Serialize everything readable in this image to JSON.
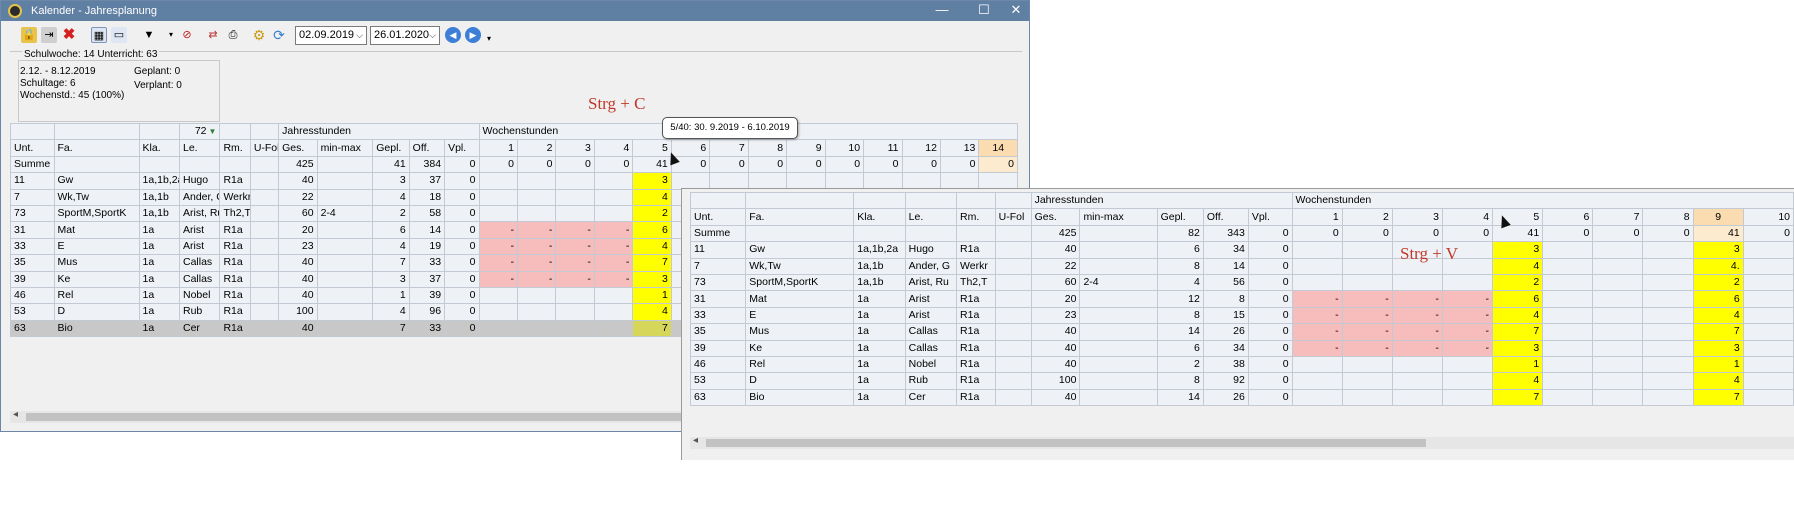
{
  "window": {
    "title": "Kalender - Jahresplanung",
    "controls": {
      "minimize": "—",
      "maximize": "☐",
      "close": "✕"
    }
  },
  "toolbar": {
    "date_from": "02.09.2019",
    "date_to": "26.01.2020"
  },
  "info": {
    "header": "Schulwoche: 14  Unterricht: 63",
    "range": "2.12. - 8.12.2019",
    "schultage": "Schultage: 6",
    "wochenstd": "Wochenstd.: 45 (100%)",
    "geplant": "Geplant: 0",
    "verplant": "Verplant: 0"
  },
  "hints": {
    "copy": "Strg + C",
    "paste": "Strg + V"
  },
  "tooltip": "5/40: 30. 9.2019 - 6.10.2019",
  "grid1": {
    "filter_count": "72",
    "group_jahres": "Jahresstunden",
    "group_wochen": "Wochenstunden",
    "columns": [
      "Unt.",
      "Fa.",
      "Kla.",
      "Le.",
      "Rm.",
      "U-Fol",
      "Ges.",
      "min-max",
      "Gepl.",
      "Off.",
      "Vpl.",
      "1",
      "2",
      "3",
      "4",
      "5",
      "6",
      "7",
      "8",
      "9",
      "10",
      "11",
      "12",
      "13",
      "14"
    ],
    "summe": {
      "label": "Summe",
      "ges": "425",
      "gepl": "41",
      "off": "384",
      "vpl": "0",
      "weeks": [
        "0",
        "0",
        "0",
        "0",
        "41",
        "0",
        "0",
        "0",
        "0",
        "0",
        "0",
        "0",
        "0",
        "0"
      ]
    },
    "rows": [
      {
        "unt": "11",
        "fa": "Gw",
        "kla": "1a,1b,2a",
        "le": "Hugo",
        "rm": "R1a",
        "ges": "40",
        "mm": "",
        "gepl": "3",
        "off": "37",
        "vpl": "0",
        "w": [
          "",
          "",
          "",
          "",
          "3"
        ]
      },
      {
        "unt": "7",
        "fa": "Wk,Tw",
        "kla": "1a,1b",
        "le": "Ander, G",
        "rm": "Werkr",
        "ges": "22",
        "mm": "",
        "gepl": "4",
        "off": "18",
        "vpl": "0",
        "w": [
          "",
          "",
          "",
          "",
          "4"
        ]
      },
      {
        "unt": "73",
        "fa": "SportM,SportK",
        "kla": "1a,1b",
        "le": "Arist, Ru",
        "rm": "Th2,T",
        "ges": "60",
        "mm": "2-4",
        "gepl": "2",
        "off": "58",
        "vpl": "0",
        "w": [
          "",
          "",
          "",
          "",
          "2"
        ]
      },
      {
        "unt": "31",
        "fa": "Mat",
        "kla": "1a",
        "le": "Arist",
        "rm": "R1a",
        "ges": "20",
        "mm": "",
        "gepl": "6",
        "off": "14",
        "vpl": "0",
        "w": [
          "-",
          "-",
          "-",
          "-",
          "6"
        ]
      },
      {
        "unt": "33",
        "fa": "E",
        "kla": "1a",
        "le": "Arist",
        "rm": "R1a",
        "ges": "23",
        "mm": "",
        "gepl": "4",
        "off": "19",
        "vpl": "0",
        "w": [
          "-",
          "-",
          "-",
          "-",
          "4"
        ]
      },
      {
        "unt": "35",
        "fa": "Mus",
        "kla": "1a",
        "le": "Callas",
        "rm": "R1a",
        "ges": "40",
        "mm": "",
        "gepl": "7",
        "off": "33",
        "vpl": "0",
        "w": [
          "-",
          "-",
          "-",
          "-",
          "7"
        ]
      },
      {
        "unt": "39",
        "fa": "Ke",
        "kla": "1a",
        "le": "Callas",
        "rm": "R1a",
        "ges": "40",
        "mm": "",
        "gepl": "3",
        "off": "37",
        "vpl": "0",
        "w": [
          "-",
          "-",
          "-",
          "-",
          "3"
        ]
      },
      {
        "unt": "46",
        "fa": "Rel",
        "kla": "1a",
        "le": "Nobel",
        "rm": "R1a",
        "ges": "40",
        "mm": "",
        "gepl": "1",
        "off": "39",
        "vpl": "0",
        "w": [
          "",
          "",
          "",
          "",
          "1"
        ]
      },
      {
        "unt": "53",
        "fa": "D",
        "kla": "1a",
        "le": "Rub",
        "rm": "R1a",
        "ges": "100",
        "mm": "",
        "gepl": "4",
        "off": "96",
        "vpl": "0",
        "w": [
          "",
          "",
          "",
          "",
          "4"
        ]
      },
      {
        "unt": "63",
        "fa": "Bio",
        "kla": "1a",
        "le": "Cer",
        "rm": "R1a",
        "ges": "40",
        "mm": "",
        "gepl": "7",
        "off": "33",
        "vpl": "0",
        "w": [
          "",
          "",
          "",
          "",
          "7"
        ]
      }
    ]
  },
  "grid2": {
    "group_jahres": "Jahresstunden",
    "group_wochen": "Wochenstunden",
    "columns": [
      "Unt.",
      "Fa.",
      "Kla.",
      "Le.",
      "Rm.",
      "U-Fol",
      "Ges.",
      "min-max",
      "Gepl.",
      "Off.",
      "Vpl.",
      "1",
      "2",
      "3",
      "4",
      "5",
      "6",
      "7",
      "8",
      "9",
      "10"
    ],
    "summe": {
      "label": "Summe",
      "ges": "425",
      "gepl": "82",
      "off": "343",
      "vpl": "0",
      "weeks": [
        "0",
        "0",
        "0",
        "0",
        "41",
        "0",
        "0",
        "0",
        "41",
        "0"
      ]
    },
    "rows": [
      {
        "unt": "11",
        "fa": "Gw",
        "kla": "1a,1b,2a",
        "le": "Hugo",
        "rm": "R1a",
        "ges": "40",
        "mm": "",
        "gepl": "6",
        "off": "34",
        "vpl": "0",
        "w": [
          "",
          "",
          "",
          "",
          "3",
          "",
          "",
          "",
          "3"
        ]
      },
      {
        "unt": "7",
        "fa": "Wk,Tw",
        "kla": "1a,1b",
        "le": "Ander, G",
        "rm": "Werkr",
        "ges": "22",
        "mm": "",
        "gepl": "8",
        "off": "14",
        "vpl": "0",
        "w": [
          "",
          "",
          "",
          "",
          "4",
          "",
          "",
          "",
          "4."
        ]
      },
      {
        "unt": "73",
        "fa": "SportM,SportK",
        "kla": "1a,1b",
        "le": "Arist, Ru",
        "rm": "Th2,T",
        "ges": "60",
        "mm": "2-4",
        "gepl": "4",
        "off": "56",
        "vpl": "0",
        "w": [
          "",
          "",
          "",
          "",
          "2",
          "",
          "",
          "",
          "2"
        ]
      },
      {
        "unt": "31",
        "fa": "Mat",
        "kla": "1a",
        "le": "Arist",
        "rm": "R1a",
        "ges": "20",
        "mm": "",
        "gepl": "12",
        "off": "8",
        "vpl": "0",
        "w": [
          "-",
          "-",
          "-",
          "-",
          "6",
          "",
          "",
          "",
          "6"
        ]
      },
      {
        "unt": "33",
        "fa": "E",
        "kla": "1a",
        "le": "Arist",
        "rm": "R1a",
        "ges": "23",
        "mm": "",
        "gepl": "8",
        "off": "15",
        "vpl": "0",
        "w": [
          "-",
          "-",
          "-",
          "-",
          "4",
          "",
          "",
          "",
          "4"
        ]
      },
      {
        "unt": "35",
        "fa": "Mus",
        "kla": "1a",
        "le": "Callas",
        "rm": "R1a",
        "ges": "40",
        "mm": "",
        "gepl": "14",
        "off": "26",
        "vpl": "0",
        "w": [
          "-",
          "-",
          "-",
          "-",
          "7",
          "",
          "",
          "",
          "7"
        ]
      },
      {
        "unt": "39",
        "fa": "Ke",
        "kla": "1a",
        "le": "Callas",
        "rm": "R1a",
        "ges": "40",
        "mm": "",
        "gepl": "6",
        "off": "34",
        "vpl": "0",
        "w": [
          "-",
          "-",
          "-",
          "-",
          "3",
          "",
          "",
          "",
          "3"
        ]
      },
      {
        "unt": "46",
        "fa": "Rel",
        "kla": "1a",
        "le": "Nobel",
        "rm": "R1a",
        "ges": "40",
        "mm": "",
        "gepl": "2",
        "off": "38",
        "vpl": "0",
        "w": [
          "",
          "",
          "",
          "",
          "1",
          "",
          "",
          "",
          "1"
        ]
      },
      {
        "unt": "53",
        "fa": "D",
        "kla": "1a",
        "le": "Rub",
        "rm": "R1a",
        "ges": "100",
        "mm": "",
        "gepl": "8",
        "off": "92",
        "vpl": "0",
        "w": [
          "",
          "",
          "",
          "",
          "4",
          "",
          "",
          "",
          "4"
        ]
      },
      {
        "unt": "63",
        "fa": "Bio",
        "kla": "1a",
        "le": "Cer",
        "rm": "R1a",
        "ges": "40",
        "mm": "",
        "gepl": "14",
        "off": "26",
        "vpl": "0",
        "w": [
          "",
          "",
          "",
          "",
          "7",
          "",
          "",
          "",
          "7"
        ]
      }
    ]
  }
}
